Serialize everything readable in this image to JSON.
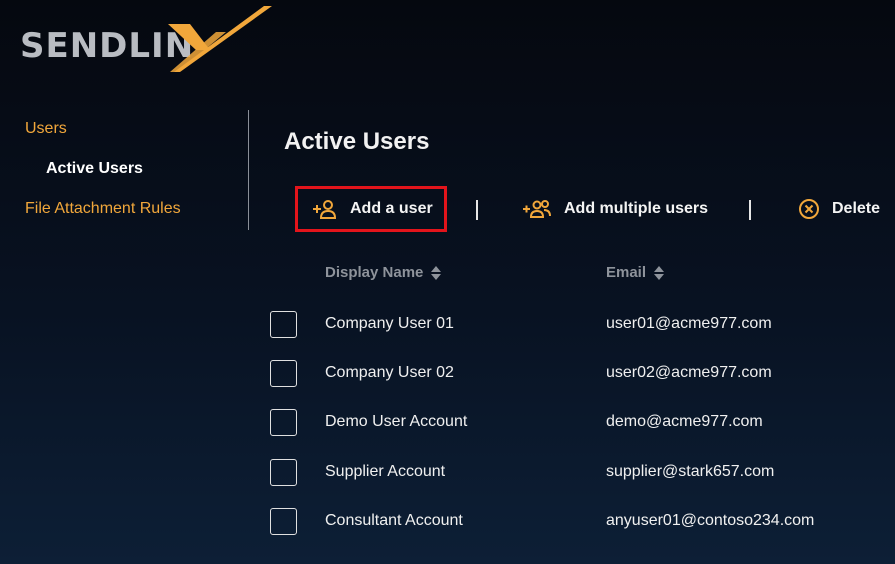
{
  "brand": {
    "logo_text": "SENDLIN",
    "accent": "#f1a73b"
  },
  "sidebar": {
    "items": [
      {
        "label": "Users"
      },
      {
        "label": "Active Users"
      },
      {
        "label": "File Attachment Rules"
      }
    ]
  },
  "main": {
    "title": "Active Users",
    "toolbar": {
      "add_user": "Add a user",
      "add_multiple": "Add multiple users",
      "delete": "Delete"
    },
    "table": {
      "columns": [
        "Display Name",
        "Email"
      ],
      "rows": [
        {
          "name": "Company User 01",
          "email": "user01@acme977.com"
        },
        {
          "name": "Company User 02",
          "email": "user02@acme977.com"
        },
        {
          "name": "Demo User Account",
          "email": "demo@acme977.com"
        },
        {
          "name": "Supplier Account",
          "email": "supplier@stark657.com"
        },
        {
          "name": "Consultant Account",
          "email": "anyuser01@contoso234.com"
        }
      ]
    }
  }
}
